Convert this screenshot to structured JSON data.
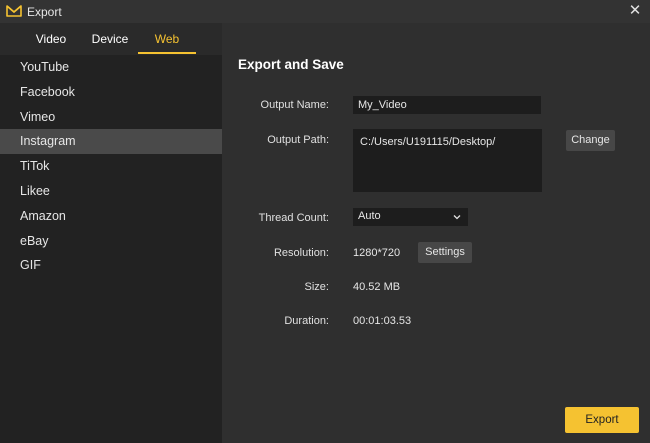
{
  "window": {
    "title": "Export",
    "close_glyph": "✕"
  },
  "tabs": [
    {
      "label": "Video"
    },
    {
      "label": "Device"
    },
    {
      "label": "Web",
      "active": true
    }
  ],
  "platforms": [
    {
      "label": "YouTube"
    },
    {
      "label": "Facebook"
    },
    {
      "label": "Vimeo"
    },
    {
      "label": "Instagram",
      "selected": true
    },
    {
      "label": "TiTok"
    },
    {
      "label": "Likee"
    },
    {
      "label": "Amazon"
    },
    {
      "label": "eBay"
    },
    {
      "label": "GIF"
    }
  ],
  "form": {
    "heading": "Export and Save",
    "output_name_label": "Output Name:",
    "output_name_value": "My_Video",
    "output_path_label": "Output Path:",
    "output_path_value": "C:/Users/U191115/Desktop/",
    "change_label": "Change",
    "thread_count_label": "Thread Count:",
    "thread_count_value": "Auto",
    "resolution_label": "Resolution:",
    "resolution_value": "1280*720",
    "settings_label": "Settings",
    "size_label": "Size:",
    "size_value": "40.52 MB",
    "duration_label": "Duration:",
    "duration_value": "00:01:03.53"
  },
  "actions": {
    "export_label": "Export"
  },
  "colors": {
    "accent": "#f5c231",
    "background": "#2f2f2f",
    "sidebar": "#222222",
    "selected": "#4a4a4a"
  },
  "icons": {
    "app": "app-logo-icon",
    "close": "close-icon",
    "dropdown": "chevron-down-icon"
  }
}
